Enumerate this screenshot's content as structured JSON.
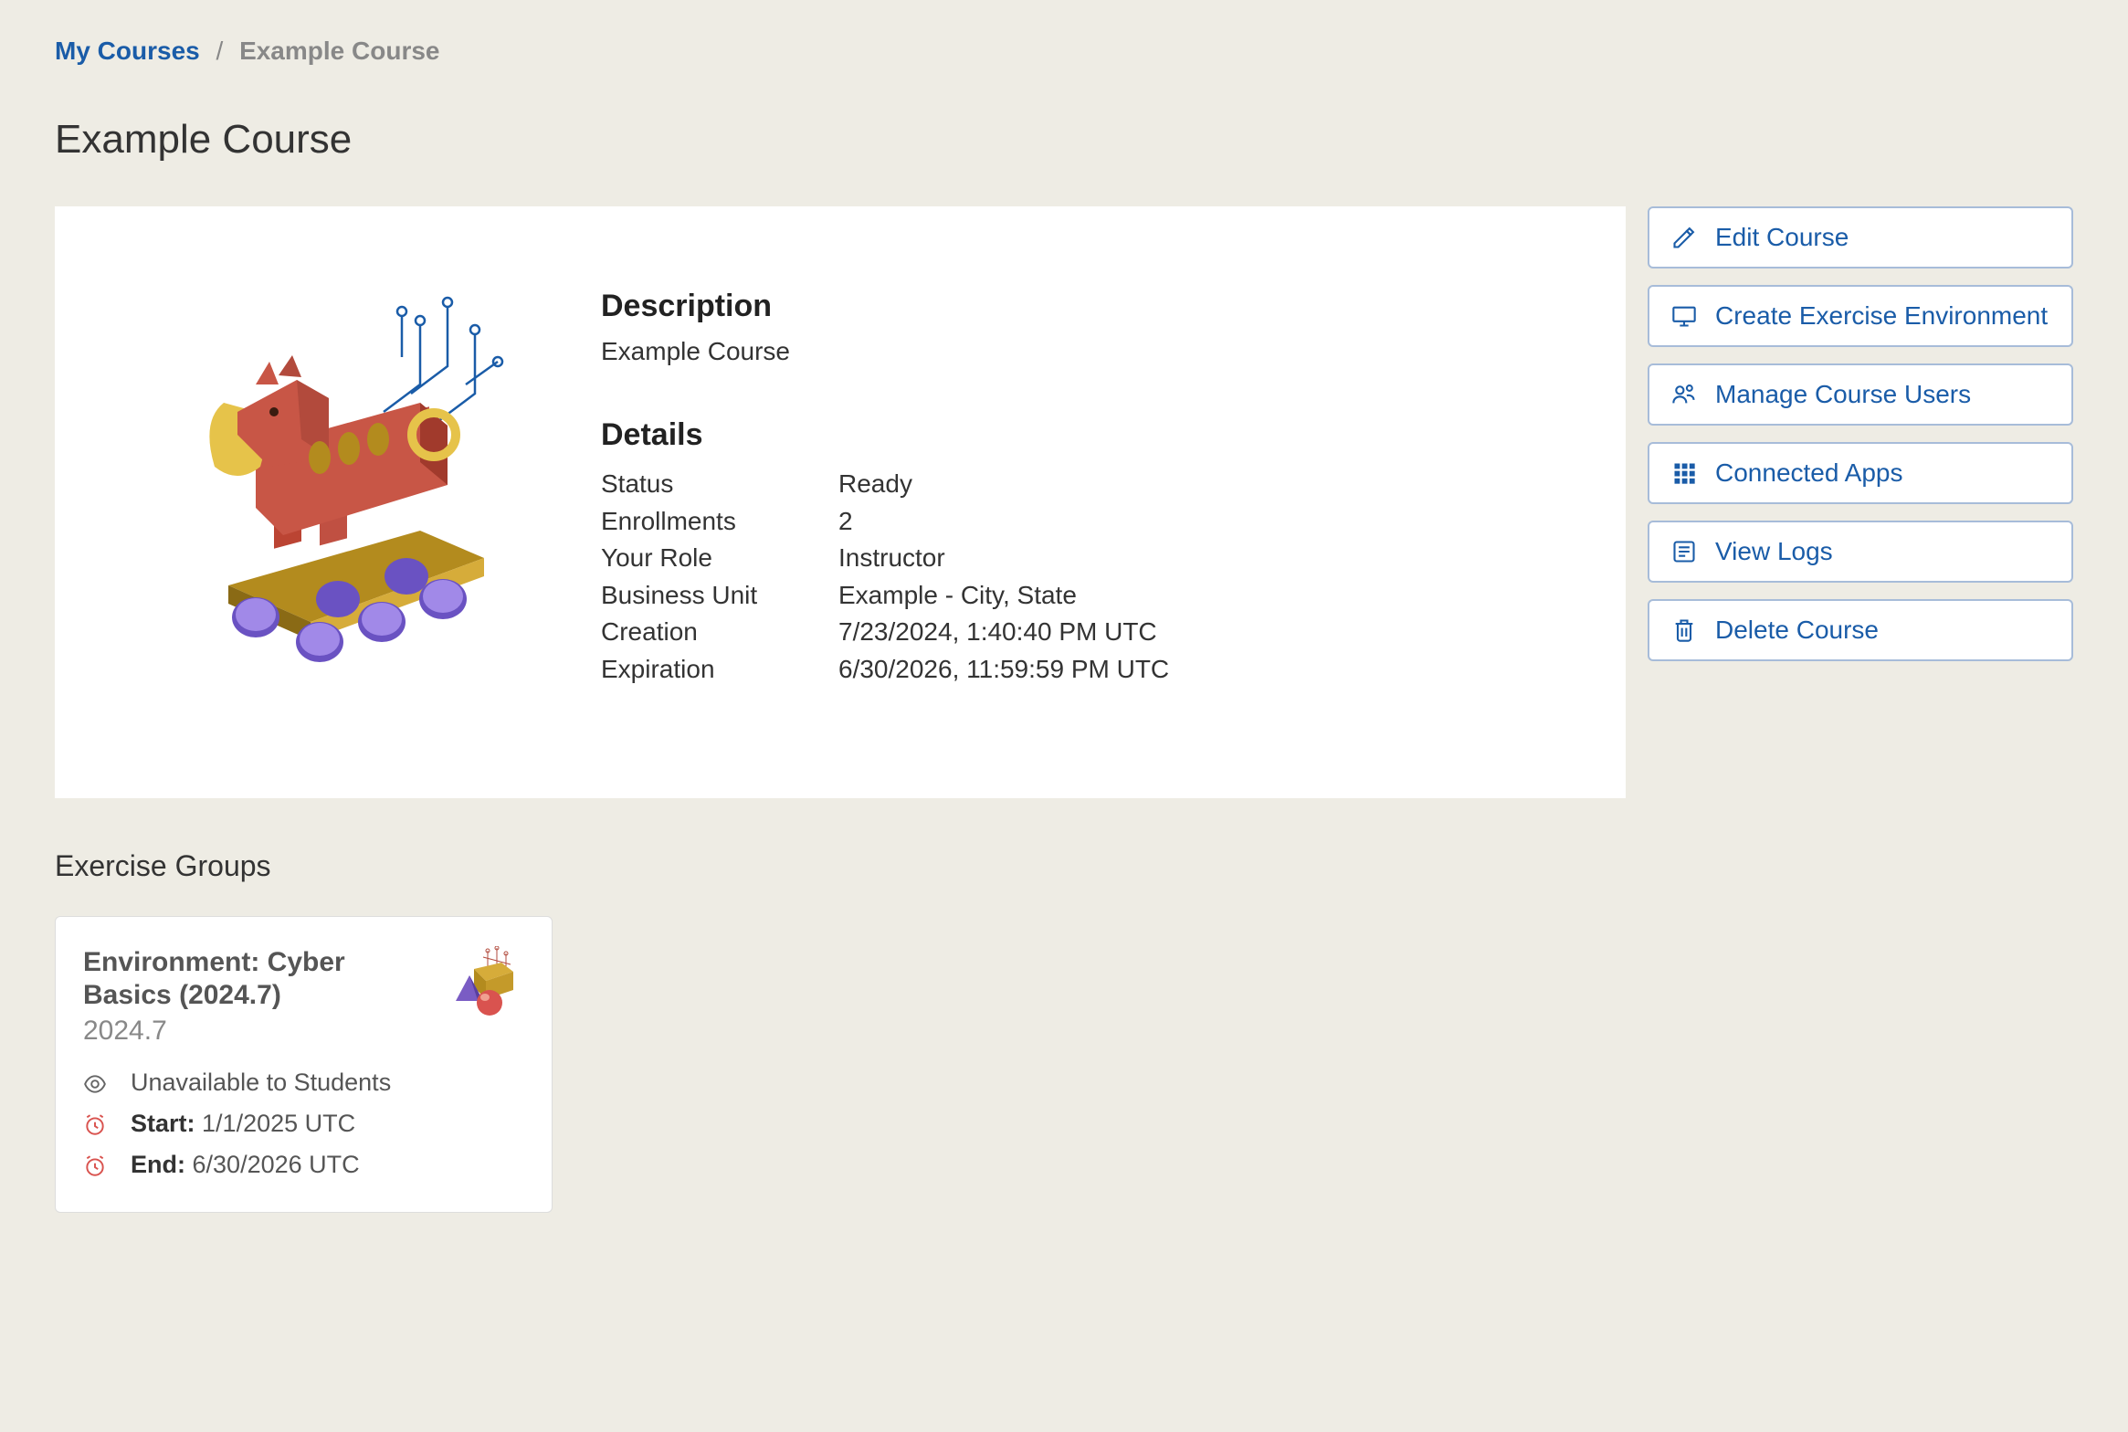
{
  "breadcrumb": {
    "parent_label": "My Courses",
    "current_label": "Example Course"
  },
  "page_title": "Example Course",
  "course": {
    "description_heading": "Description",
    "description_text": "Example Course",
    "details_heading": "Details",
    "details": {
      "status": {
        "label": "Status",
        "value": "Ready"
      },
      "enrollments": {
        "label": "Enrollments",
        "value": "2"
      },
      "your_role": {
        "label": "Your Role",
        "value": "Instructor"
      },
      "business_unit": {
        "label": "Business Unit",
        "value": "Example - City, State"
      },
      "creation": {
        "label": "Creation",
        "value": "7/23/2024, 1:40:40 PM UTC"
      },
      "expiration": {
        "label": "Expiration",
        "value": "6/30/2026, 11:59:59 PM UTC"
      }
    }
  },
  "actions": {
    "edit": "Edit Course",
    "create_env": "Create Exercise Environment",
    "manage_users": "Manage Course Users",
    "connected_apps": "Connected Apps",
    "view_logs": "View Logs",
    "delete": "Delete Course"
  },
  "exercise_groups": {
    "heading": "Exercise Groups",
    "items": [
      {
        "title": "Environment: Cyber Basics (2024.7)",
        "version": "2024.7",
        "availability": "Unavailable to Students",
        "start_label": "Start:",
        "start_value": "1/1/2025 UTC",
        "end_label": "End:",
        "end_value": "6/30/2026 UTC"
      }
    ]
  }
}
